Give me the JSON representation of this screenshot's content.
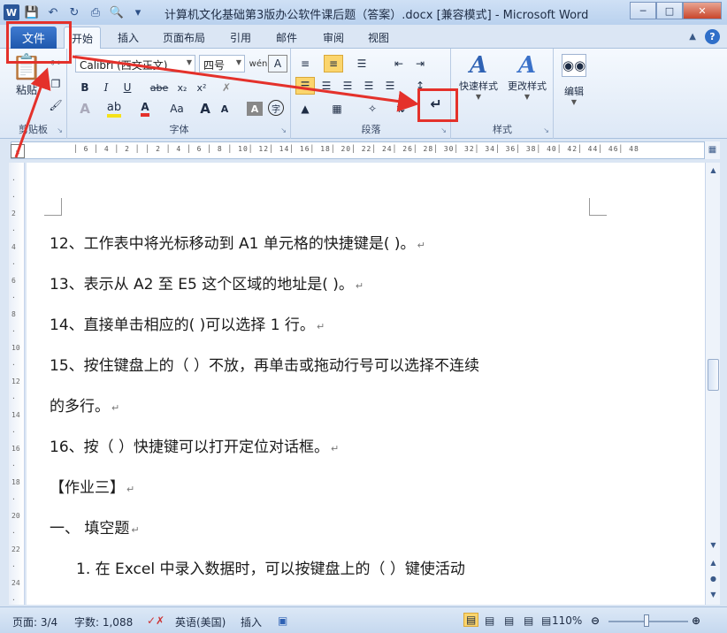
{
  "window": {
    "title": "计算机文化基础第3版办公软件课后题（答案）.docx [兼容模式] - Microsoft Word",
    "app_logo": "W",
    "buttons": {
      "minimize": "─",
      "maximize": "□",
      "close": "✕"
    }
  },
  "quick_access": {
    "icons": [
      "save-icon",
      "undo-icon",
      "redo-icon",
      "print-icon",
      "print-preview-icon",
      "customize-icon"
    ]
  },
  "tabs": {
    "file": "文件",
    "items": [
      "开始",
      "插入",
      "页面布局",
      "引用",
      "邮件",
      "审阅",
      "视图"
    ],
    "active_index": 0
  },
  "ribbon": {
    "clipboard": {
      "paste": "粘贴",
      "label": "剪贴板"
    },
    "font": {
      "font_name": "Calibri (西文正文)",
      "font_size": "四号",
      "bold": "B",
      "italic": "I",
      "underline": "U",
      "strike": "abe",
      "subscript": "x₂",
      "superscript": "x²",
      "case": "Aa",
      "grow": "A",
      "shrink": "A",
      "char_border": "A",
      "phonetic": "wén",
      "encircle": "字",
      "label": "字体"
    },
    "paragraph": {
      "label": "段落"
    },
    "styles": {
      "quick_styles": "快速样式",
      "change_styles": "更改样式",
      "label": "样式"
    },
    "editing": {
      "label": "编辑"
    }
  },
  "ruler": {
    "ticks": "│ 6 │ 4 │ 2 │   │ 2 │ 4 │ 6 │ 8 │ 10│ 12│ 14│ 16│ 18│ 20│ 22│ 24│ 26│ 28│ 30│ 32│ 34│ 36│ 38│ 40│ 42│ 44│ 46│ 48"
  },
  "document": {
    "lines": [
      {
        "text": "12、工作表中将光标移动到 A1 单元格的快捷键是(        )。",
        "mark": "↵"
      },
      {
        "text": "13、表示从 A2 至 E5 这个区域的地址是(          )。",
        "mark": "↵"
      },
      {
        "text": "14、直接单击相应的(          )可以选择 1 行。",
        "mark": "↵"
      },
      {
        "text": "15、按住键盘上的（    ）不放，再单击或拖动行号可以选择不连续",
        "mark": ""
      },
      {
        "text": "的多行。",
        "mark": "↵"
      },
      {
        "text": "16、按（    ）快捷键可以打开定位对话框。",
        "mark": "↵"
      },
      {
        "text": "【作业三】",
        "mark": "↵"
      },
      {
        "text": "一、   填空题",
        "mark": "↵"
      },
      {
        "text": "1.  在 Excel 中录入数据时，可以按键盘上的（          ）键使活动",
        "mark": ""
      }
    ]
  },
  "statusbar": {
    "page": "页面: 3/4",
    "words": "字数: 1,088",
    "language": "英语(美国)",
    "insert_mode": "插入",
    "zoom": "110%"
  },
  "colors": {
    "accent": "#2a5699",
    "annotation": "#e4312b"
  }
}
